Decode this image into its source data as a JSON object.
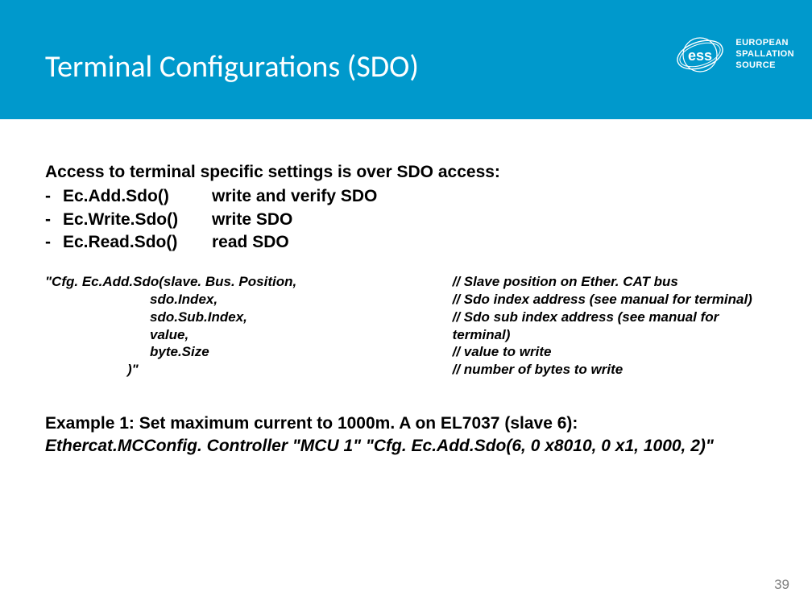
{
  "header": {
    "title": "Terminal Configurations (SDO)",
    "logo_line1": "EUROPEAN",
    "logo_line2": "SPALLATION",
    "logo_line3": "SOURCE",
    "logo_abbrev": "ess"
  },
  "intro": "Access to terminal specific settings is over SDO access:",
  "functions": [
    {
      "name": "Ec.Add.Sdo()",
      "desc": "write and verify SDO"
    },
    {
      "name": "Ec.Write.Sdo()",
      "desc": "write SDO"
    },
    {
      "name": "Ec.Read.Sdo()",
      "desc": "read SDO"
    }
  ],
  "code": {
    "lines": [
      "\"Cfg. Ec.Add.Sdo(slave. Bus. Position,",
      "sdo.Index,",
      "sdo.Sub.Index,",
      "value,",
      "byte.Size"
    ],
    "end": ")\"",
    "comments": [
      "// Slave position on Ether. CAT bus",
      "// Sdo index address (see manual for terminal)",
      "// Sdo sub index address (see manual for terminal)",
      "// value to write",
      "// number of bytes to write"
    ]
  },
  "example": {
    "title": "Example 1: Set maximum current to 1000m. A on EL7037 (slave 6):",
    "code": "Ethercat.MCConfig. Controller  \"MCU 1\" \"Cfg. Ec.Add.Sdo(6, 0 x8010, 0 x1, 1000, 2)\""
  },
  "page_number": "39"
}
